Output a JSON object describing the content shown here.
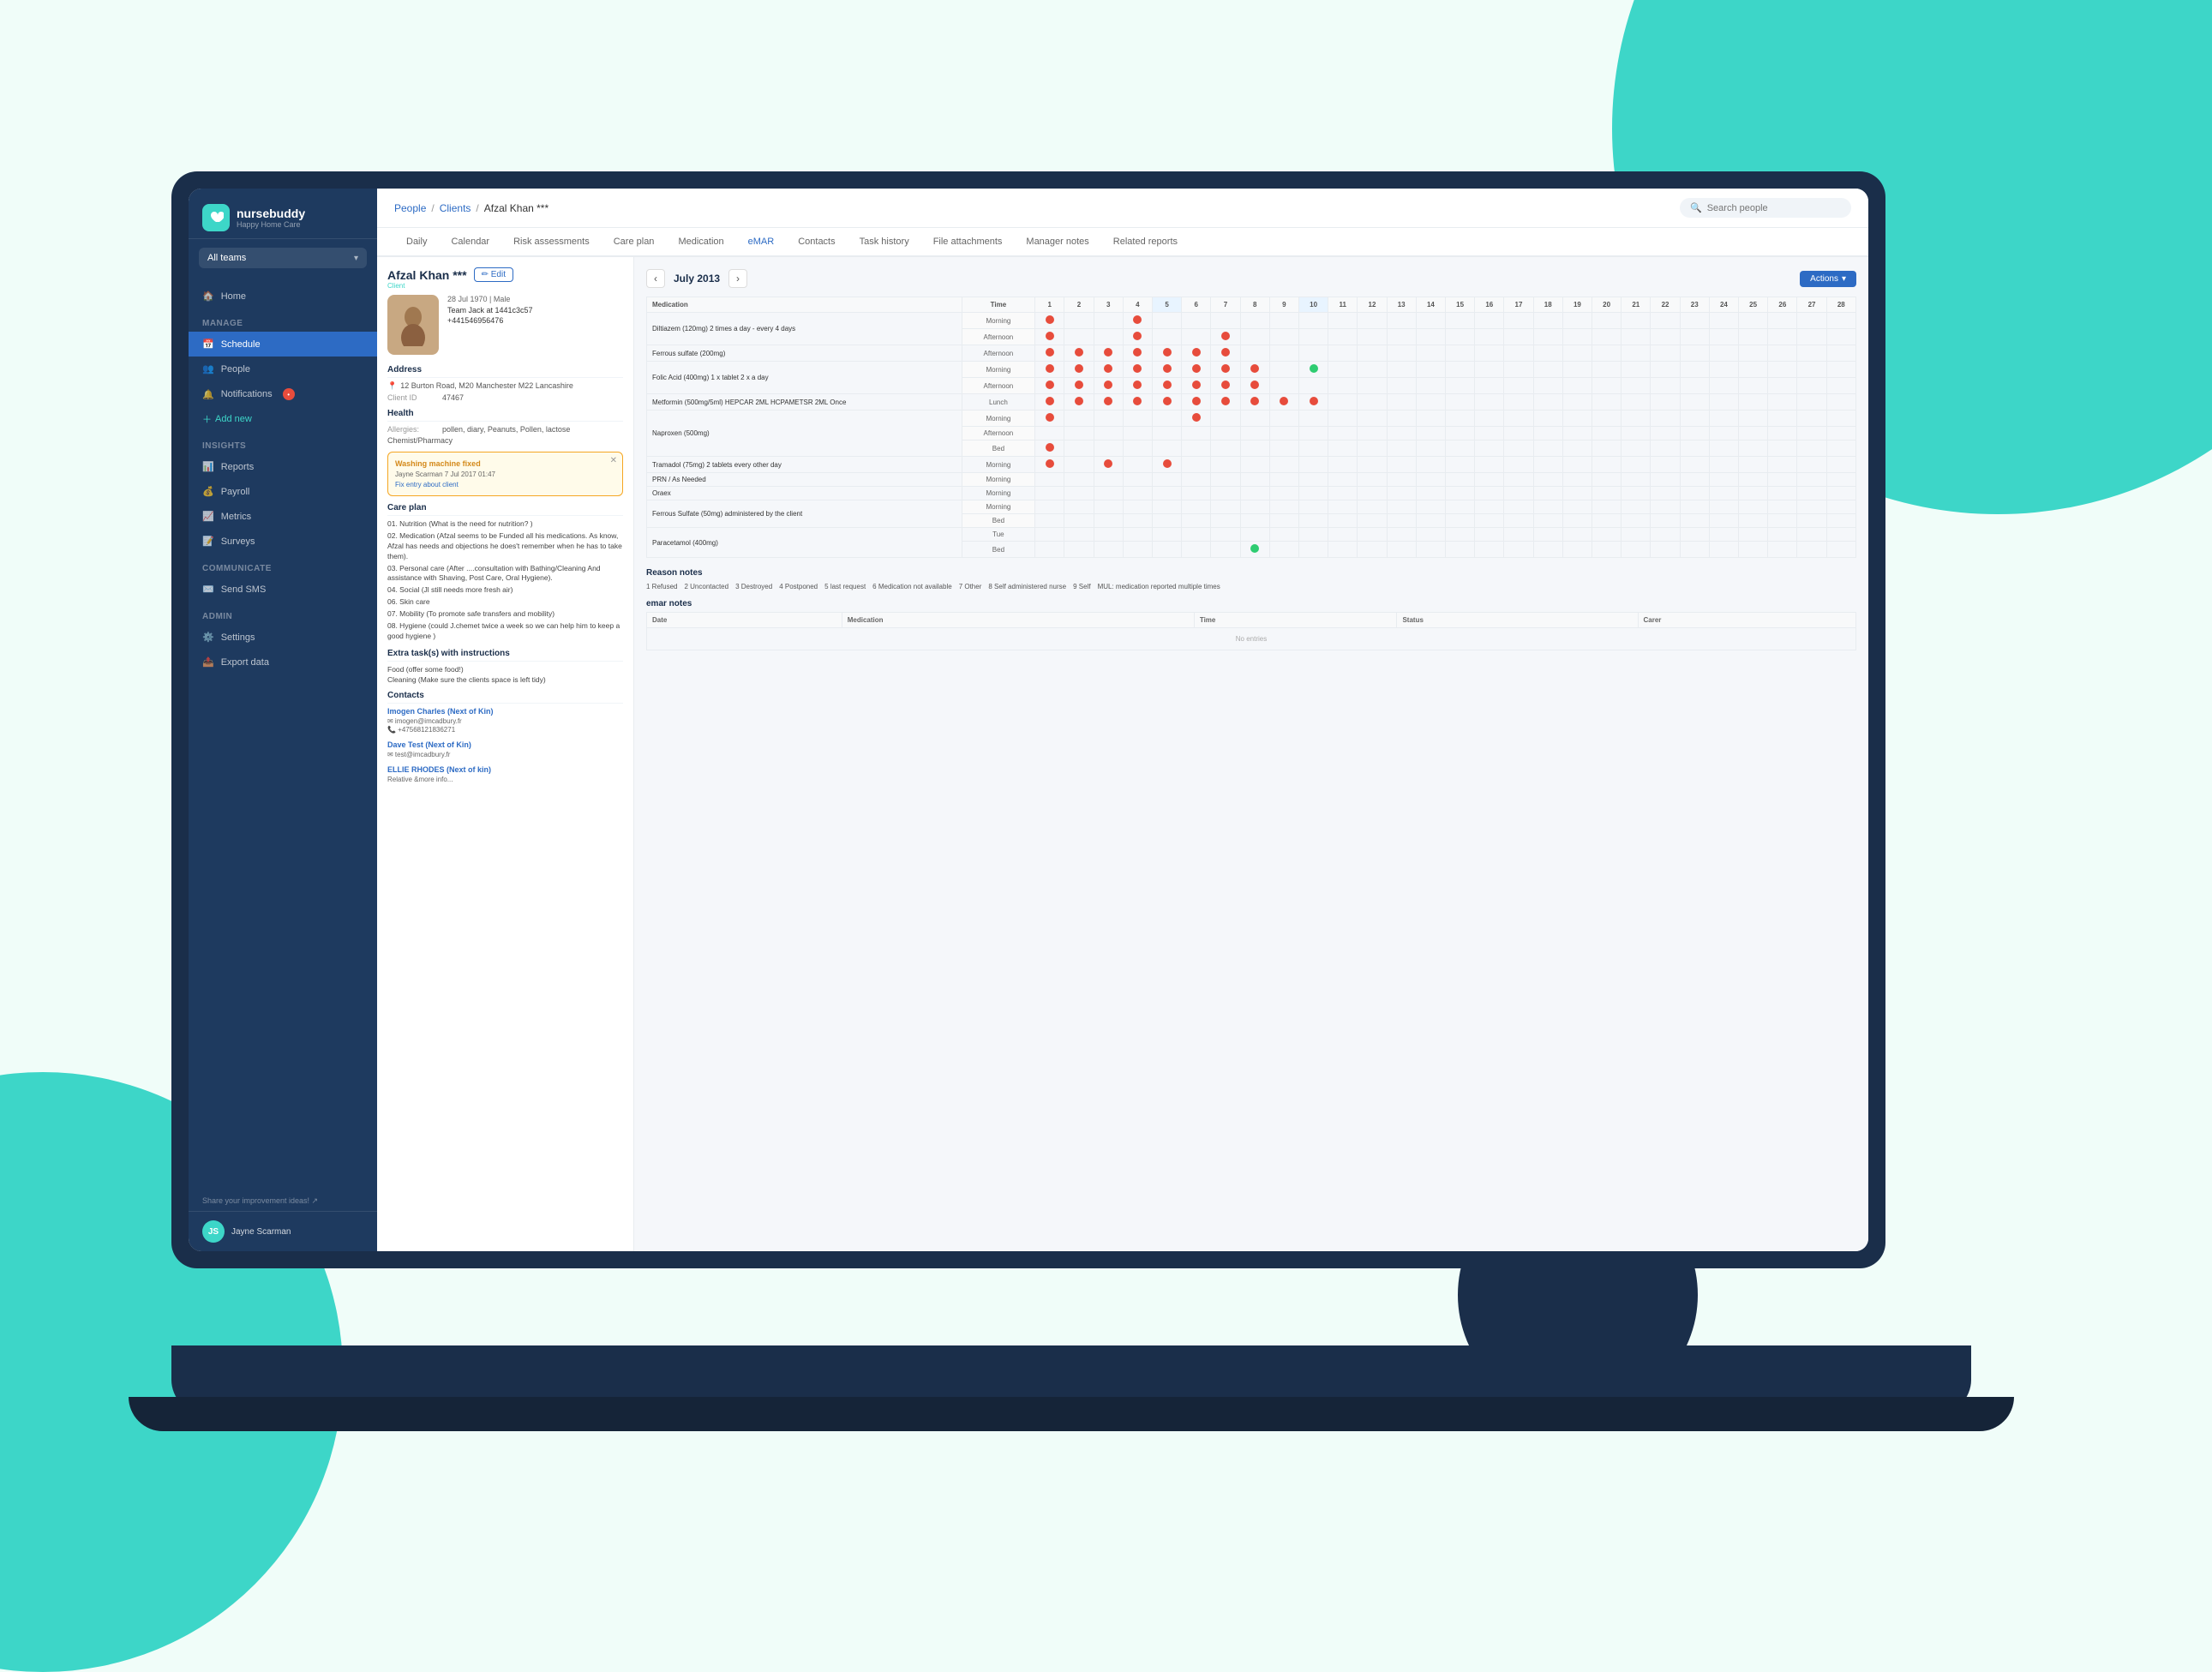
{
  "background": {
    "shape1_color": "#3dd6c8",
    "shape2_color": "#3dd6c8",
    "ball_color": "#1a2e4a"
  },
  "sidebar": {
    "logo_text": "nursebuddy",
    "logo_subtitle": "Happy Home Care",
    "logo_icon": "♥",
    "team_selector": "All teams",
    "nav_items": [
      {
        "label": "Home",
        "section": "",
        "active": false,
        "has_badge": false
      },
      {
        "label": "Schedule",
        "section": "Manage",
        "active": true,
        "has_badge": false
      },
      {
        "label": "People",
        "section": "",
        "active": false,
        "has_badge": false
      },
      {
        "label": "Notifications",
        "section": "",
        "active": false,
        "has_badge": true
      },
      {
        "label": "+ Add new",
        "section": "",
        "active": false,
        "has_badge": false
      },
      {
        "label": "Reports",
        "section": "Insights",
        "active": false,
        "has_badge": false
      },
      {
        "label": "Payroll",
        "section": "",
        "active": false,
        "has_badge": false
      },
      {
        "label": "Metrics",
        "section": "",
        "active": false,
        "has_badge": false
      },
      {
        "label": "Surveys",
        "section": "",
        "active": false,
        "has_badge": false
      },
      {
        "label": "Send SMS",
        "section": "Communicate",
        "active": false,
        "has_badge": false
      },
      {
        "label": "Settings",
        "section": "Admin",
        "active": false,
        "has_badge": false
      },
      {
        "label": "Export data",
        "section": "",
        "active": false,
        "has_badge": false
      }
    ],
    "share_ideas": "Share your improvement ideas! ↗",
    "user_name": "Jayne Scarman"
  },
  "topbar": {
    "breadcrumb": {
      "people": "People",
      "clients": "Clients",
      "patient": "Afzal Khan ***"
    },
    "search_placeholder": "Search people"
  },
  "tabs": [
    "Daily",
    "Calendar",
    "Risk assessments",
    "Care plan",
    "Medication",
    "eMAR",
    "Contacts",
    "Task history",
    "File attachments",
    "Manager notes",
    "Related reports"
  ],
  "active_tab": "eMAR",
  "patient": {
    "name": "Afzal Khan ***",
    "dob": "28 Jul 1970 | Male",
    "team": "Team Jack at 1441c3c57",
    "phone": "+441546956476",
    "address": "12 Burton Road, M20\nManchester M22\nLancashire",
    "id_label": "Client ID",
    "id_value": "47467",
    "allergies": "pollen, diary, Peanuts, Pollen, lactose",
    "chemist": "Chemist/Pharmacy",
    "notification": {
      "title": "Washing machine fixed",
      "text": "Jayne Scarman 7 Jul 2017 01:47",
      "link": "Fix entry about client"
    },
    "care_plan": {
      "title": "Care plan",
      "items": [
        "01. Nutrition (What is the need for nutrition? )",
        "02. Medication (Afzal seems to be Funded all his medications. As know, Afzal has needs and objections he does't remember when he has to take them).",
        "03. Personal care (After ....consultation with Bathing/Cleaning And assistance with Shaving, Post Care, Oral Hygiene).",
        "04. Social (Jl still needs more fresh air)",
        "06. Skin care",
        "07. Mobility (To promote safe transfers and mobility)",
        "08. Hygiene (could J.chemet twice a week so we can help him to keep a good hygiene )"
      ]
    },
    "extra_tasks": {
      "title": "Extra task(s) with instructions",
      "items": [
        "Food (offer some food!)",
        "Cleaning (Make sure the clients space is left tidy)"
      ]
    },
    "contacts": {
      "title": "Contacts",
      "items": [
        {
          "name": "Imogen Charles (Next of Kin)",
          "email": "imogen@imcadbury.fr",
          "phone": "+47568121836271"
        },
        {
          "name": "Dave Test (Next of Kin)",
          "email": "test@imcadbury.fr"
        },
        {
          "name": "ELLIE RHODES (Next of kin)",
          "detail": "Relative &more info..."
        }
      ]
    }
  },
  "mar": {
    "title": "eMAR",
    "month": "July 2013",
    "days": [
      1,
      2,
      3,
      4,
      5,
      6,
      7,
      8,
      9,
      10,
      11,
      12,
      13,
      14,
      15,
      16,
      17,
      18,
      19,
      20,
      21,
      22,
      23,
      24,
      25,
      26,
      27,
      28
    ],
    "actions_label": "Actions",
    "medications": [
      {
        "name": "Diltiazem (120mg)\n2 times a day - every 4 days",
        "times": [
          "Morning",
          "Afternoon"
        ],
        "doses": {
          "Morning": [
            1,
            0,
            0,
            1,
            0,
            0,
            0,
            0,
            0,
            0,
            0,
            0,
            0,
            0,
            0,
            0,
            0,
            0,
            0,
            0,
            0,
            0,
            0,
            0,
            0,
            0,
            0,
            0
          ],
          "Afternoon": [
            1,
            0,
            0,
            1,
            0,
            0,
            1,
            0,
            0,
            0,
            0,
            0,
            0,
            0,
            0,
            0,
            0,
            0,
            0,
            0,
            0,
            0,
            0,
            0,
            0,
            0,
            0,
            0
          ]
        }
      },
      {
        "name": "Ferrous sulfate (200mg)",
        "times": [
          "Afternoon"
        ],
        "doses": {
          "Afternoon": [
            1,
            1,
            1,
            1,
            1,
            1,
            1,
            0,
            0,
            0,
            0,
            0,
            0,
            0,
            0,
            0,
            0,
            0,
            0,
            0,
            0,
            0,
            0,
            0,
            0,
            0,
            0,
            0
          ]
        }
      },
      {
        "name": "Folic Acid (400mg)\n1 x tablet 2 x a day",
        "times": [
          "Morning",
          "Afternoon"
        ],
        "doses": {
          "Morning": [
            1,
            1,
            1,
            1,
            1,
            1,
            1,
            1,
            0,
            2,
            0,
            0,
            0,
            0,
            0,
            0,
            0,
            0,
            0,
            0,
            0,
            0,
            0,
            0,
            0,
            0,
            0,
            0
          ],
          "Afternoon": [
            1,
            1,
            1,
            1,
            1,
            1,
            1,
            1,
            0,
            0,
            0,
            0,
            0,
            0,
            0,
            0,
            0,
            0,
            0,
            0,
            0,
            0,
            0,
            0,
            0,
            0,
            0,
            0
          ]
        }
      },
      {
        "name": "Metformin (500mg/5ml)\nHEPCAR 2ML\nHCPAMETSR 2ML\nOnce",
        "times": [
          "Lunch"
        ],
        "doses": {
          "Lunch": [
            1,
            1,
            1,
            1,
            1,
            1,
            1,
            1,
            1,
            1,
            0,
            0,
            0,
            0,
            0,
            0,
            0,
            0,
            0,
            0,
            0,
            0,
            0,
            0,
            0,
            0,
            0,
            0
          ]
        }
      },
      {
        "name": "Naproxen (500mg)",
        "times": [
          "Morning",
          "Afternoon",
          "Bed"
        ],
        "doses": {
          "Morning": [
            1,
            0,
            0,
            0,
            0,
            1,
            0,
            0,
            0,
            0,
            0,
            0,
            0,
            0,
            0,
            0,
            0,
            0,
            0,
            0,
            0,
            0,
            0,
            0,
            0,
            0,
            0,
            0
          ],
          "Afternoon": [
            0,
            0,
            0,
            0,
            0,
            0,
            0,
            0,
            0,
            0,
            0,
            0,
            0,
            0,
            0,
            0,
            0,
            0,
            0,
            0,
            0,
            0,
            0,
            0,
            0,
            0,
            0,
            0
          ],
          "Bed": [
            1,
            0,
            0,
            0,
            0,
            0,
            0,
            0,
            0,
            0,
            0,
            0,
            0,
            0,
            0,
            0,
            0,
            0,
            0,
            0,
            0,
            0,
            0,
            0,
            0,
            0,
            0,
            0
          ]
        }
      },
      {
        "name": "Tramadol (75mg)\n2 tablets every other day",
        "times": [
          "Morning"
        ],
        "doses": {
          "Morning": [
            1,
            0,
            1,
            0,
            1,
            0,
            0,
            0,
            0,
            0,
            0,
            0,
            0,
            0,
            0,
            0,
            0,
            0,
            0,
            0,
            0,
            0,
            0,
            0,
            0,
            0,
            0,
            0
          ]
        }
      },
      {
        "name": "PRN / As Needed",
        "times": [
          "Morning"
        ],
        "doses": {
          "Morning": [
            0,
            0,
            0,
            0,
            0,
            0,
            0,
            0,
            0,
            0,
            0,
            0,
            0,
            0,
            0,
            0,
            0,
            0,
            0,
            0,
            0,
            0,
            0,
            0,
            0,
            0,
            0,
            0
          ]
        }
      },
      {
        "name": "Oraex",
        "times": [
          "Morning"
        ],
        "doses": {
          "Morning": [
            0,
            0,
            0,
            0,
            0,
            0,
            0,
            0,
            0,
            0,
            0,
            0,
            0,
            0,
            0,
            0,
            0,
            0,
            0,
            0,
            0,
            0,
            0,
            0,
            0,
            0,
            0,
            0
          ]
        }
      },
      {
        "name": "Ferrous Sulfate (50mg)\nadministered by the client",
        "times": [
          "Morning",
          "Bed"
        ],
        "doses": {
          "Morning": [
            0,
            0,
            0,
            0,
            0,
            0,
            0,
            0,
            0,
            0,
            0,
            0,
            0,
            0,
            0,
            0,
            0,
            0,
            0,
            0,
            0,
            0,
            0,
            0,
            0,
            0,
            0,
            0
          ],
          "Bed": [
            0,
            0,
            0,
            0,
            0,
            0,
            0,
            0,
            0,
            0,
            0,
            0,
            0,
            0,
            0,
            0,
            0,
            0,
            0,
            0,
            0,
            0,
            0,
            0,
            0,
            0,
            0,
            0
          ]
        }
      },
      {
        "name": "Paracetamol (400mg)",
        "times": [
          "Tue",
          "Bed"
        ],
        "doses": {
          "Tue": [
            0,
            0,
            0,
            0,
            0,
            0,
            0,
            0,
            0,
            0,
            0,
            0,
            0,
            0,
            0,
            0,
            0,
            0,
            0,
            0,
            0,
            0,
            0,
            0,
            0,
            0,
            0,
            0
          ],
          "Bed": [
            0,
            0,
            0,
            0,
            0,
            0,
            0,
            2,
            0,
            0,
            0,
            0,
            0,
            0,
            0,
            0,
            0,
            0,
            0,
            0,
            0,
            0,
            0,
            0,
            0,
            0,
            0,
            0
          ]
        }
      }
    ],
    "reason_notes": {
      "title": "Reason notes",
      "legend": [
        "1 Refused",
        "2 Uncontacted",
        "3 Destroyed",
        "4 Postponed",
        "5 last request",
        "6 Medication not available",
        "7 Other",
        "8 Self administered nurse",
        "9 Self",
        "MUL: medication reported multiple times"
      ]
    },
    "emar_notes": {
      "title": "emar notes",
      "columns": [
        "Date",
        "Medication",
        "Time",
        "Status",
        "Carer"
      ]
    }
  }
}
